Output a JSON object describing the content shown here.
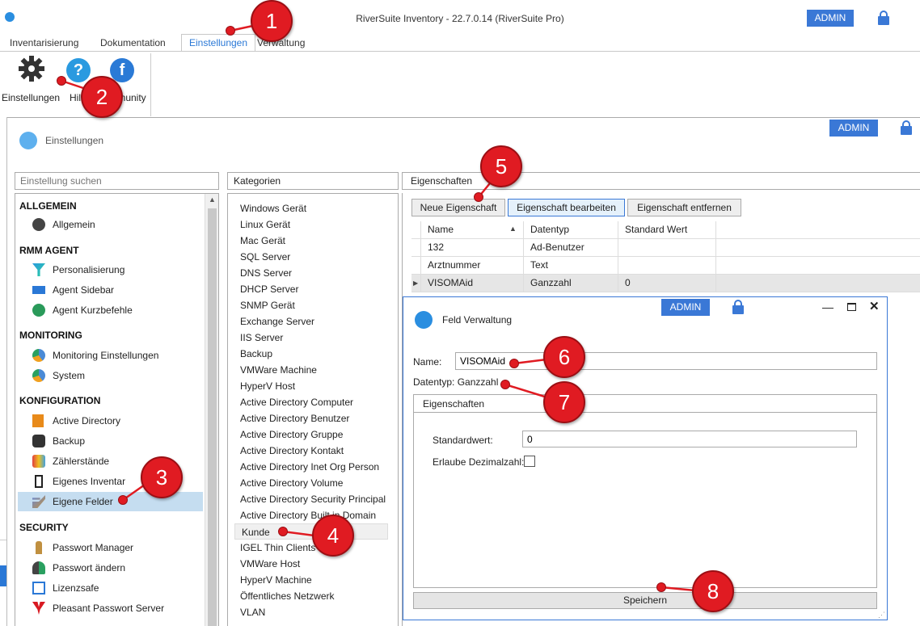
{
  "app": {
    "title": "RiverSuite Inventory - 22.7.0.14 (RiverSuite Pro)",
    "admin_badge": "ADMIN",
    "accent": "#3a78d6"
  },
  "ribbon": {
    "tabs": [
      "Inventarisierung",
      "Dokumentation",
      "Einstellungen",
      "Verwaltung"
    ],
    "active_tab": "Einstellungen",
    "buttons": {
      "settings": "Einstellungen",
      "help": "Hilfe",
      "community": "Community"
    }
  },
  "settings_window": {
    "title": "Einstellungen",
    "admin_badge": "ADMIN",
    "search_placeholder": "Einstellung suchen",
    "sections": [
      {
        "header": "ALLGEMEIN",
        "items": [
          "Allgemein"
        ]
      },
      {
        "header": "RMM AGENT",
        "items": [
          "Personalisierung",
          "Agent Sidebar",
          "Agent Kurzbefehle"
        ]
      },
      {
        "header": "MONITORING",
        "items": [
          "Monitoring Einstellungen",
          "System"
        ]
      },
      {
        "header": "KONFIGURATION",
        "items": [
          "Active Directory",
          "Backup",
          "Zählerstände",
          "Eigenes Inventar",
          "Eigene Felder"
        ]
      },
      {
        "header": "SECURITY",
        "items": [
          "Passwort Manager",
          "Passwort ändern",
          "Lizenzsafe",
          "Pleasant Passwort Server"
        ]
      }
    ],
    "selected_item": "Eigene Felder"
  },
  "kategorien": {
    "header": "Kategorien",
    "items": [
      "Windows Gerät",
      "Linux Gerät",
      "Mac Gerät",
      "SQL Server",
      "DNS Server",
      "DHCP Server",
      "SNMP Gerät",
      "Exchange Server",
      "IIS Server",
      "Backup",
      "VMWare Machine",
      "HyperV Host",
      "Active Directory Computer",
      "Active Directory Benutzer",
      "Active Directory Gruppe",
      "Active Directory Kontakt",
      "Active Directory Inet Org Person",
      "Active Directory Volume",
      "Active Directory Security Principal",
      "Active Directory Built in Domain",
      "Kunde",
      "IGEL Thin Clients",
      "VMWare Host",
      "HyperV Machine",
      "Öffentliches Netzwerk",
      "VLAN"
    ],
    "selected": "Kunde"
  },
  "eigenschaften": {
    "header": "Eigenschaften",
    "buttons": {
      "new": "Neue Eigenschaft",
      "edit": "Eigenschaft bearbeiten",
      "remove": "Eigenschaft entfernen"
    },
    "columns": [
      "Name",
      "Datentyp",
      "Standard Wert"
    ],
    "rows": [
      {
        "name": "132",
        "type": "Ad-Benutzer",
        "default": ""
      },
      {
        "name": "Arztnummer",
        "type": "Text",
        "default": ""
      },
      {
        "name": "VISOMAid",
        "type": "Ganzzahl",
        "default": "0"
      }
    ]
  },
  "dialog": {
    "title": "Feld Verwaltung",
    "admin_badge": "ADMIN",
    "name_label": "Name:",
    "name_value": "VISOMAid",
    "datentyp_text": "Datentyp: Ganzzahl",
    "group_title": "Eigenschaften",
    "standardwert_label": "Standardwert:",
    "standardwert_value": "0",
    "dezimal_label": "Erlaube Dezimalzahl:",
    "dezimal_checked": false,
    "save_label": "Speichern"
  },
  "callouts": [
    "1",
    "2",
    "3",
    "4",
    "5",
    "6",
    "7",
    "8"
  ],
  "colors": {
    "callout": "#e01b22",
    "selection": "#c5ddf0"
  }
}
